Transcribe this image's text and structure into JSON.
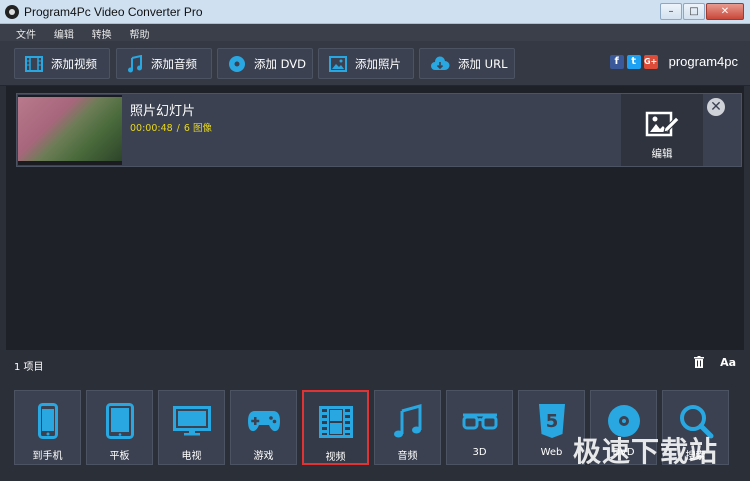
{
  "window": {
    "title": "Program4Pc Video Converter Pro",
    "minimize": "–",
    "maximize": "□",
    "close": "✕"
  },
  "menu": [
    "文件",
    "编辑",
    "转换",
    "帮助"
  ],
  "toolbar": {
    "add_video": "添加视频",
    "add_audio": "添加音频",
    "add_dvd": "添加 DVD",
    "add_photo": "添加照片",
    "add_url": "添加 URL"
  },
  "social": {
    "facebook": "f",
    "twitter": "t",
    "google": "G+",
    "logo": "program4pc"
  },
  "item": {
    "title": "照片幻灯片",
    "duration": "00:00:48",
    "separator": "/",
    "images": "6 图像",
    "edit_label": "编辑",
    "close": "✕"
  },
  "status": {
    "count": "1 项目",
    "font_button": "Aa"
  },
  "categories": [
    {
      "label": "到手机",
      "icon": "phone-icon"
    },
    {
      "label": "平板",
      "icon": "tablet-icon"
    },
    {
      "label": "电视",
      "icon": "tv-icon"
    },
    {
      "label": "游戏",
      "icon": "gamepad-icon"
    },
    {
      "label": "视频",
      "icon": "film-icon",
      "selected": true
    },
    {
      "label": "音频",
      "icon": "music-icon"
    },
    {
      "label": "3D",
      "icon": "3d-glasses-icon"
    },
    {
      "label": "Web",
      "icon": "html5-icon"
    },
    {
      "label": "DVD",
      "icon": "disc-icon"
    },
    {
      "label": "搜索",
      "icon": "search-icon"
    }
  ],
  "watermark": "极速下载站",
  "colors": {
    "accent": "#29a7e1",
    "selected_border": "#e03333",
    "meta": "#e8d820"
  }
}
